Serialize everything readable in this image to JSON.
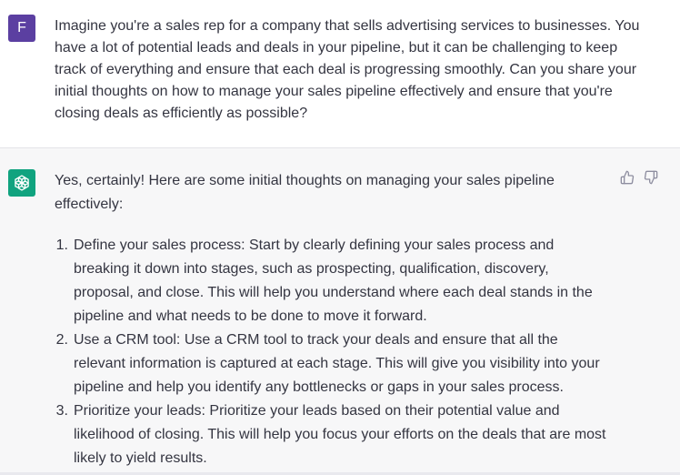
{
  "user_message": {
    "avatar_letter": "F",
    "text": "Imagine you're a sales rep for a company that sells advertising services to businesses. You have a lot of potential leads and deals in your pipeline, but it can be challenging to keep track of everything and ensure that each deal is progressing smoothly. Can you share your initial thoughts on how to manage your sales pipeline effectively and ensure that you're closing deals as efficiently as possible?"
  },
  "assistant_message": {
    "intro": "Yes, certainly! Here are some initial thoughts on managing your sales pipeline effectively:",
    "points": [
      {
        "num": "1.",
        "text": "Define your sales process: Start by clearly defining your sales process and breaking it down into stages, such as prospecting, qualification, discovery, proposal, and close. This will help you understand where each deal stands in the pipeline and what needs to be done to move it forward."
      },
      {
        "num": "2.",
        "text": "Use a CRM tool: Use a CRM tool to track your deals and ensure that all the relevant information is captured at each stage. This will give you visibility into your pipeline and help you identify any bottlenecks or gaps in your sales process."
      },
      {
        "num": "3.",
        "text": "Prioritize your leads: Prioritize your leads based on their potential value and likelihood of closing. This will help you focus your efforts on the deals that are most likely to yield results."
      }
    ]
  },
  "icons": {
    "user_avatar_color": "#5b3fa1",
    "bot_avatar_color": "#10a37f",
    "bot_avatar_icon": "openai-logo-icon",
    "thumbs_up": "thumbs-up-icon",
    "thumbs_down": "thumbs-down-icon"
  }
}
